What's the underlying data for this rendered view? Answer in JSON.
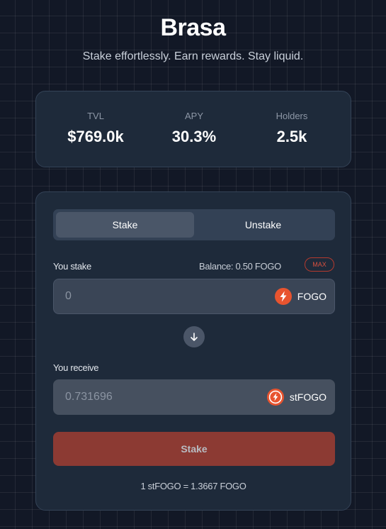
{
  "app": {
    "title": "Brasa",
    "subtitle": "Stake effortlessly. Earn rewards. Stay liquid."
  },
  "stats": [
    {
      "label": "TVL",
      "value": "$769.0k"
    },
    {
      "label": "APY",
      "value": "30.3%"
    },
    {
      "label": "Holders",
      "value": "2.5k"
    }
  ],
  "tabs": {
    "stake_label": "Stake",
    "unstake_label": "Unstake",
    "active": "Stake"
  },
  "stake_field": {
    "label": "You stake",
    "balance": "Balance: 0.50 FOGO",
    "max_label": "MAX",
    "placeholder": "0",
    "token": "FOGO",
    "token_icon": "fogo-flame-icon"
  },
  "receive_field": {
    "label": "You receive",
    "value": "0.731696",
    "token": "stFOGO",
    "token_icon": "stfogo-flame-icon"
  },
  "swap_icon": "arrow-down-icon",
  "action": {
    "label": "Stake"
  },
  "rate": "1 stFOGO = 1.3667 FOGO",
  "colors": {
    "accent": "#e8542f",
    "button": "#8c3a33",
    "card": "#1e2a3a",
    "background": "#121826"
  }
}
